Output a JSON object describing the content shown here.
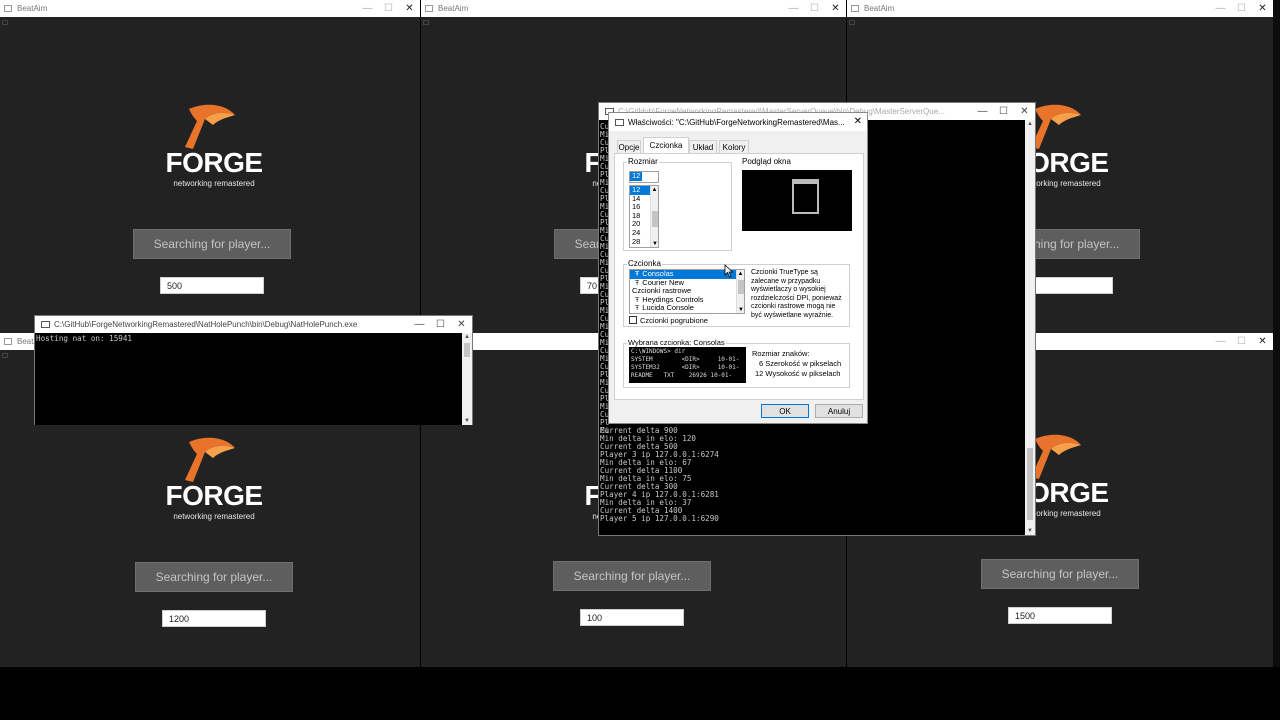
{
  "app_title": "BeatAim",
  "window_controls": {
    "minimize": "—",
    "maximize": "☐",
    "close": "✕"
  },
  "logo": {
    "word": "FORGE",
    "tagline": "networking remastered"
  },
  "game_windows": [
    {
      "button": "Searching for player...",
      "value": "500"
    },
    {
      "button": "Searching for player...",
      "value": "1200"
    },
    {
      "button": "Searching for player...",
      "value": "70"
    },
    {
      "button": "Searching for player...",
      "value": "100"
    },
    {
      "button": "Searching for player...",
      "value": ""
    },
    {
      "button": "Searching for player...",
      "value": "1500"
    }
  ],
  "nat_console": {
    "title": "C:\\GitHub\\ForgeNetworkingRemastered\\NatHolePunch\\bin\\Debug\\NatHolePunch.exe",
    "lines": [
      "Hosting nat on: 15941"
    ]
  },
  "master_console": {
    "title": "C:\\GitHub\\ForgeNetworkingRemastered\\MasterServerQueue\\bin\\Debug\\MasterServerQue...",
    "peek_left": [
      "Cu",
      "Mi",
      "Cu",
      "Pl",
      "Mi",
      "Cu",
      "Pl",
      "Mi",
      "Cu",
      "Pl",
      "Mi",
      "Cu",
      "Pl",
      "Mi",
      "Cu",
      "Mi",
      "Cu",
      "Mi",
      "Cu",
      "Pl",
      "Mi",
      "Cu",
      "Pl",
      "Mi",
      "Cu",
      "Mi",
      "Cu",
      "Mi",
      "Cu",
      "Mi",
      "Cu",
      "Pl",
      "Mi",
      "Cu",
      "Pl",
      "Mi",
      "Cu",
      "Pl",
      "Mi"
    ],
    "lines": [
      "Current delta 900",
      "Min delta in elo: 120",
      "Current delta 500",
      "Player 3 ip 127.0.0.1:6274",
      "Min delta in elo: 67",
      "Current delta 1100",
      "Min delta in elo: 75",
      "Current delta 300",
      "Player 4 ip 127.0.0.1:6281",
      "Min delta in elo: 37",
      "Current delta 1400",
      "Player 5 ip 127.0.0.1:6290"
    ]
  },
  "props_dialog": {
    "title": "Właściwości: \"C:\\GitHub\\ForgeNetworkingRemastered\\Mas...",
    "tabs": [
      "Opcje",
      "Czcionka",
      "Układ",
      "Kolory"
    ],
    "selected_tab": "Czcionka",
    "size_group": "Rozmiar",
    "size_value": "12",
    "sizes": [
      "12",
      "14",
      "16",
      "18",
      "20",
      "24",
      "28"
    ],
    "preview_group": "Podgląd okna",
    "font_group": "Czcionka",
    "fonts": [
      "Consolas",
      "Courier New",
      "Czcionki rastrowe",
      "Heydings Controls",
      "Lucida Console"
    ],
    "font_desc": "Czcionki TrueType są zalecane w przypadku wyświetlaczy o wysokiej rozdzielczości DPI, ponieważ czcionki rastrowe mogą nie być wyświetlane wyraźnie.",
    "bold_label": "Czcionki pogrubione",
    "selected_font_label": "Wybrana czcionka: Consolas",
    "sample_lines": [
      "C:\\WINDOWS> dir",
      "SYSTEM        <DIR>     10-01-",
      "SYSTEM32      <DIR>     10-01-",
      "README   TXT    26926 10-01-"
    ],
    "char_size_title": "Rozmiar znaków:",
    "char_width": "6  Szerokość w pikselach",
    "char_height": "12  Wysokość w pikselach",
    "ok": "OK",
    "cancel": "Anuluj"
  },
  "colors": {
    "accent": "#e8742c",
    "accent_light": "#f6a04a",
    "window_bg": "#222222",
    "selection": "#0078d7"
  }
}
